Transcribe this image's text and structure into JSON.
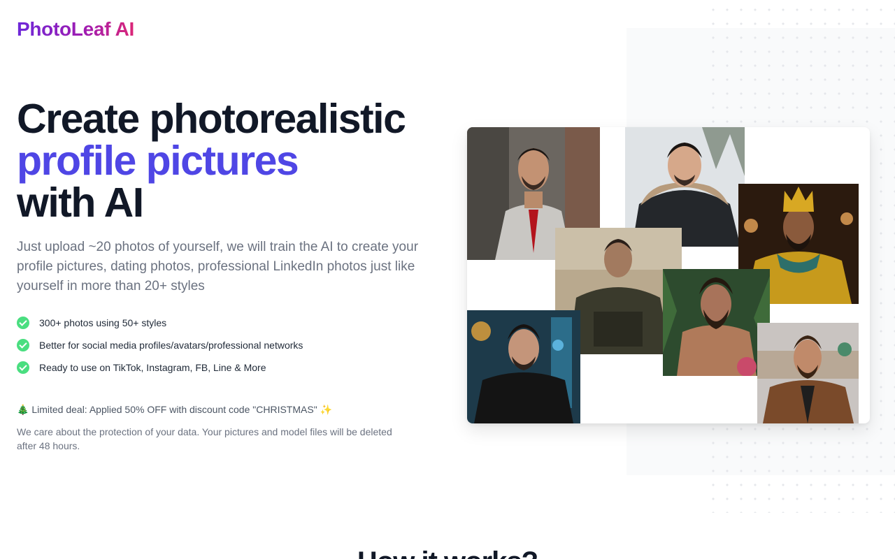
{
  "brand": {
    "logo_text": "PhotoLeaf AI"
  },
  "hero": {
    "title_line1": "Create photorealistic",
    "title_line2": "profile pictures",
    "title_line3": "with AI",
    "description": "Just upload ~20 photos of yourself, we will train the AI to create your profile pictures, dating photos, professional LinkedIn photos just like yourself in more than 20+ styles",
    "features": [
      {
        "icon": "check-circle-icon",
        "text": "300+ photos using 50+ styles"
      },
      {
        "icon": "check-circle-icon",
        "text": "Better for social media profiles/avatars/professional networks"
      },
      {
        "icon": "check-circle-icon",
        "text": "Ready to use on TikTok, Instagram, FB, Line & More"
      }
    ],
    "deal": "🎄 Limited deal: Applied 50% OFF with discount code \"CHRISTMAS\" ✨",
    "privacy": "We care about the protection of your data. Your pictures and model files will be deleted after 48 hours."
  },
  "collage": {
    "photos": [
      "man-in-suit-portrait",
      "man-in-winter-coat-portrait",
      "king-costume-portrait",
      "soldier-portrait",
      "shirtless-forest-portrait",
      "city-night-jacket-portrait",
      "brown-coat-city-portrait"
    ]
  },
  "next_section": {
    "title": "How it works?"
  },
  "colors": {
    "title_dark": "#111827",
    "title_accent": "#4f46e5",
    "check_green": "#4ade80",
    "logo_gradient": [
      "#6d28d9",
      "#db2777"
    ]
  }
}
